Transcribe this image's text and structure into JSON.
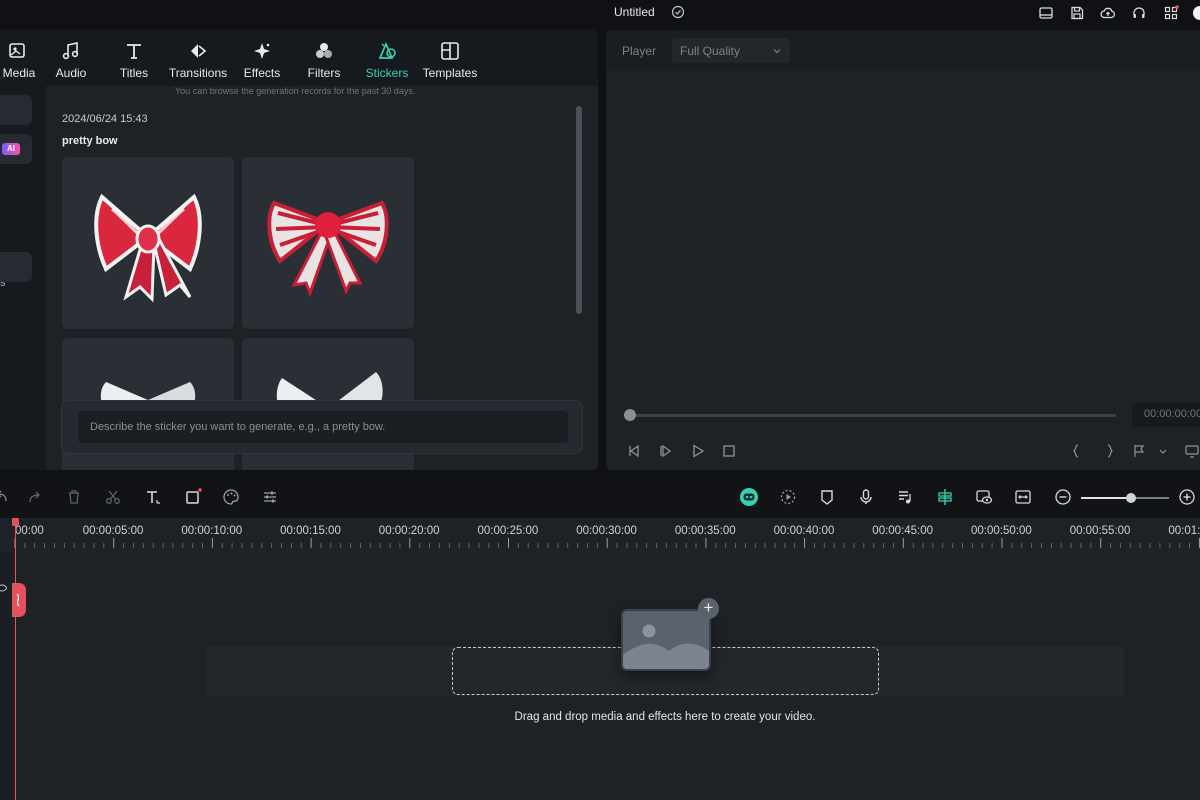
{
  "window": {
    "title": "Untitled",
    "top_icons": [
      "layout-icon",
      "save-icon",
      "cloud-upload-icon",
      "headset-icon",
      "apps-grid-icon"
    ]
  },
  "tabs": [
    {
      "label": "Media",
      "icon": "import-media-icon"
    },
    {
      "label": "Audio",
      "icon": "music-note-icon"
    },
    {
      "label": "Titles",
      "icon": "text-t-icon"
    },
    {
      "label": "Transitions",
      "icon": "transition-arrows-icon"
    },
    {
      "label": "Effects",
      "icon": "sparkle-icon"
    },
    {
      "label": "Filters",
      "icon": "filters-circles-icon"
    },
    {
      "label": "Stickers",
      "icon": "sticker-icon",
      "active": true
    },
    {
      "label": "Templates",
      "icon": "templates-icon"
    }
  ],
  "sidebar": {
    "ai_badge": "AI",
    "partial_label": "s"
  },
  "stickers_panel": {
    "hint": "You can browse the generation records for the past 30 days.",
    "record_date": "2024/06/24 15:43",
    "record_prompt": "pretty bow",
    "input_placeholder": "Describe the sticker you want to generate, e.g., a pretty bow."
  },
  "player": {
    "label": "Player",
    "quality": "Full Quality",
    "timecode": "00:00:00:00",
    "progress": 0
  },
  "toolbar": {
    "zoom_level": 0.57
  },
  "timeline": {
    "ruler_labels": [
      "00:00",
      "00:00:05:00",
      "00:00:10:00",
      "00:00:15:00",
      "00:00:20:00",
      "00:00:25:00",
      "00:00:30:00",
      "00:00:35:00",
      "00:00:40:00",
      "00:00:45:00",
      "00:00:50:00",
      "00:00:55:00",
      "00:01:"
    ],
    "drop_message": "Drag and drop media and effects here to create your video."
  },
  "colors": {
    "accent": "#36d0b4",
    "playhead": "#e2525a",
    "panel": "#1e2227",
    "background": "#0f1114"
  }
}
